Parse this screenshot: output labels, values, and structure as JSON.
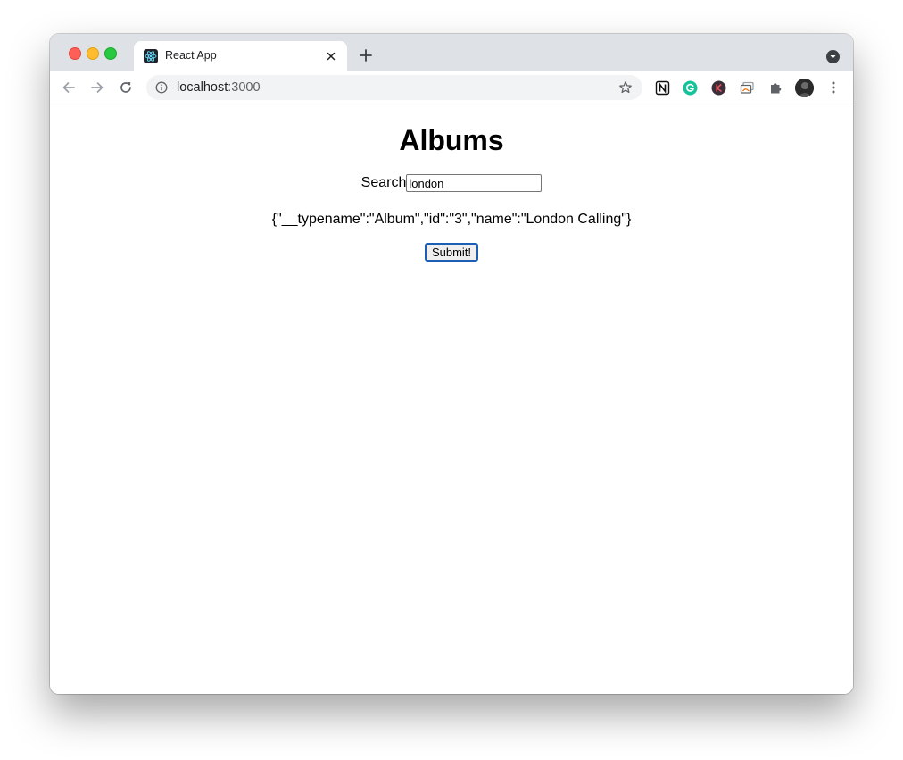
{
  "browser": {
    "tab": {
      "title": "React App",
      "favicon": "react-logo-icon"
    },
    "address": {
      "host": "localhost",
      "port": ":3000"
    },
    "extensions": [
      "notion-icon",
      "grammarly-icon",
      "k-extension-icon",
      "screen-capture-icon",
      "puzzle-extensions-icon"
    ],
    "colors": {
      "titlebar": "#dee1e6",
      "omnibox": "#f1f3f4",
      "grammarly": "#15c39a",
      "react": "#61dafb"
    }
  },
  "page": {
    "title": "Albums",
    "search": {
      "label": "Search",
      "value": "london"
    },
    "result": "{\"__typename\":\"Album\",\"id\":\"3\",\"name\":\"London Calling\"}",
    "submit_label": "Submit!"
  }
}
